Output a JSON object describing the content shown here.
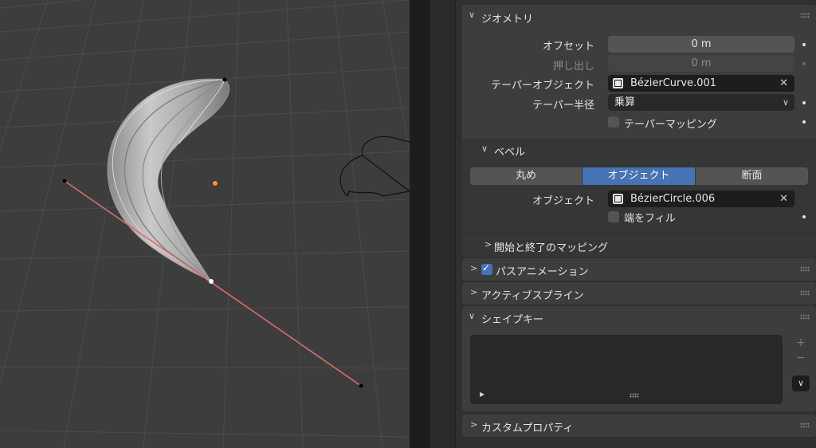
{
  "geometry_panel": {
    "title": "ジオメトリ",
    "offset_label": "オフセット",
    "offset_value": "0 m",
    "extrude_label": "押し出し",
    "extrude_value": "0 m",
    "taper_object_label": "テーパーオブジェクト",
    "taper_object_value": "BézierCurve.001",
    "taper_radius_label": "テーパー半径",
    "taper_radius_value": "乗算",
    "taper_mapping_label": "テーパーマッピング",
    "taper_mapping_checked": false
  },
  "bevel_panel": {
    "title": "ベベル",
    "modes": [
      "丸め",
      "オブジェクト",
      "断面"
    ],
    "active_mode": "オブジェクト",
    "object_label": "オブジェクト",
    "object_value": "BézierCircle.006",
    "fill_caps_label": "端をフィル",
    "fill_caps_checked": false,
    "mapping_label": "開始と終了のマッピング"
  },
  "path_animation_panel": {
    "title": "パスアニメーション",
    "enabled": true
  },
  "active_spline_panel": {
    "title": "アクティブスプライン"
  },
  "shape_keys_panel": {
    "title": "シェイプキー",
    "add_label": "+",
    "remove_label": "−"
  },
  "custom_properties_panel": {
    "title": "カスタムプロパティ"
  },
  "icons": {
    "expanded": "chevron-down-icon",
    "collapsed": "chevron-right-icon",
    "curve_object": "curve-object-icon",
    "clear": "close-icon",
    "dropdown": "chevron-down-icon",
    "play": "play-icon",
    "drag": "drag-handle-icon"
  },
  "colors": {
    "accent": "#4772b3",
    "viewport_bg": "#3d3d3d",
    "panel_bg": "#3d3d3d",
    "editor_bg": "#303030",
    "curve_line": "#e06a6a",
    "origin": "#f0903a",
    "mesh": "#b8b8b8"
  }
}
